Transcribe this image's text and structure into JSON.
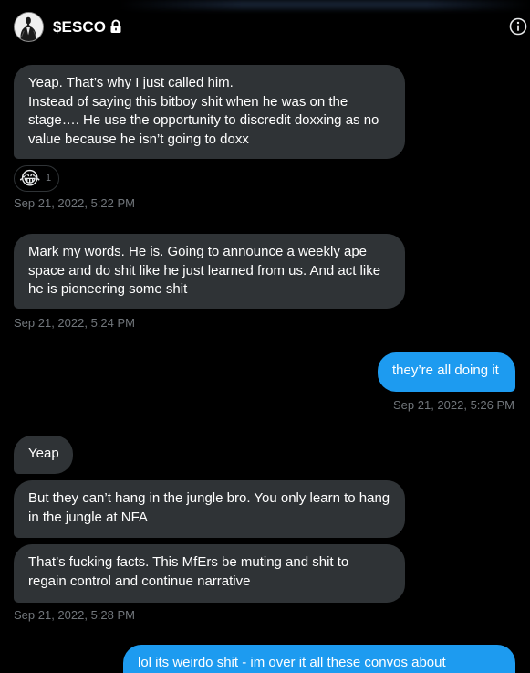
{
  "header": {
    "name": "$ESCO",
    "avatar_icon": "avatar",
    "lock_icon": "lock-icon",
    "info_icon": "info-icon"
  },
  "messages": [
    {
      "direction": "received",
      "lines": [
        "Yeap. That’s why I just called him.",
        "Instead of saying this bitboy shit when he was on the",
        "stage…. He use the opportunity to discredit doxxing as no",
        "value because he isn’t going to doxx"
      ],
      "reaction": {
        "emoji": "😂",
        "count": "1"
      },
      "timestamp": "Sep 21, 2022, 5:22 PM"
    },
    {
      "direction": "received",
      "lines": [
        "Mark my words. He is. Going to announce a weekly ape",
        "space and do shit like he just learned from us. And act like",
        "he is pioneering some shit"
      ],
      "timestamp": "Sep 21, 2022, 5:24 PM"
    },
    {
      "direction": "sent",
      "lines": [
        "they’re all doing it"
      ],
      "timestamp": "Sep 21, 2022, 5:26 PM"
    },
    {
      "direction": "received",
      "lines": [
        "Yeap"
      ]
    },
    {
      "direction": "received",
      "lines": [
        "But they can’t hang in the jungle bro. You only learn to hang",
        "in the jungle at NFA"
      ]
    },
    {
      "direction": "received",
      "lines": [
        "That’s fucking facts. This MfErs be muting and shit to",
        "regain control and continue narrative"
      ],
      "timestamp": "Sep 21, 2022, 5:28 PM"
    },
    {
      "direction": "sent",
      "lines": [
        "lol its weirdo shit - im over it all these convos about"
      ]
    }
  ],
  "colors": {
    "background": "#000000",
    "received_bubble": "#2f3336",
    "sent_bubble": "#1d9bf0",
    "timestamp": "#71767b"
  }
}
